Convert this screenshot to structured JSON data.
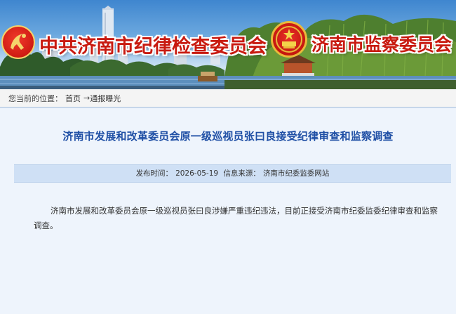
{
  "header": {
    "left_title": "中共济南市纪律检查委员会",
    "right_title": "济南市监察委员会",
    "party_emblem_icon": "party-emblem-icon",
    "state_emblem_icon": "state-emblem-icon"
  },
  "breadcrumb": {
    "prefix": "您当前的位置：",
    "home": "首页",
    "arrow": "→",
    "current": "通报曝光"
  },
  "article": {
    "title": "济南市发展和改革委员会原一级巡视员张曰良接受纪律审查和监察调查",
    "publish_label": "发布时间：",
    "publish_date": "2026-05-19",
    "source_label": "信息来源：",
    "source": "济南市纪委监委网站",
    "body": "济南市发展和改革委员会原一级巡视员张曰良涉嫌严重违纪违法，目前正接受济南市纪委监委纪律审查和监察调查。"
  },
  "colors": {
    "title_blue": "#1f4fa5",
    "banner_red": "#c81a10",
    "meta_bg": "#cfe0f5",
    "page_bg": "#eef4fc"
  }
}
